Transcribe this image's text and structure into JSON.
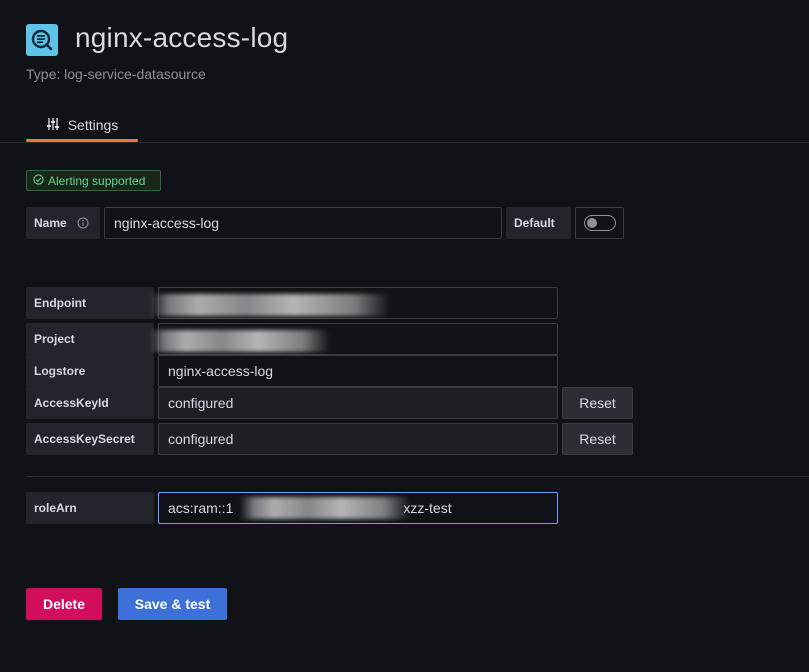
{
  "header": {
    "title": "nginx-access-log",
    "subtitle": "Type: log-service-datasource",
    "icon": "datasource-log-icon",
    "icon_color": "#5ec3e6"
  },
  "tabs": [
    {
      "label": "Settings",
      "icon": "sliders-icon",
      "active": true
    }
  ],
  "alert_badge": {
    "icon": "check-circle-icon",
    "label": "Alerting supported"
  },
  "name_row": {
    "label": "Name",
    "value": "nginx-access-log",
    "default_label": "Default",
    "default_enabled": false
  },
  "fields": {
    "endpoint": {
      "label": "Endpoint",
      "value": ""
    },
    "project": {
      "label": "Project",
      "value": ""
    },
    "logstore": {
      "label": "Logstore",
      "value": "nginx-access-log"
    },
    "access_key_id": {
      "label": "AccessKeyId",
      "value": "configured",
      "reset_label": "Reset"
    },
    "access_key_secret": {
      "label": "AccessKeySecret",
      "value": "configured",
      "reset_label": "Reset"
    },
    "role_arn": {
      "label": "roleArn",
      "value_prefix": "acs:ram::1",
      "value_suffix": "xzz-test"
    }
  },
  "actions": {
    "delete_label": "Delete",
    "save_label": "Save & test"
  },
  "colors": {
    "background": "#111217",
    "delete": "#d10e5c",
    "save": "#3d71d9",
    "tab_accent": "#f5743a",
    "success": "#6ccf8e"
  }
}
